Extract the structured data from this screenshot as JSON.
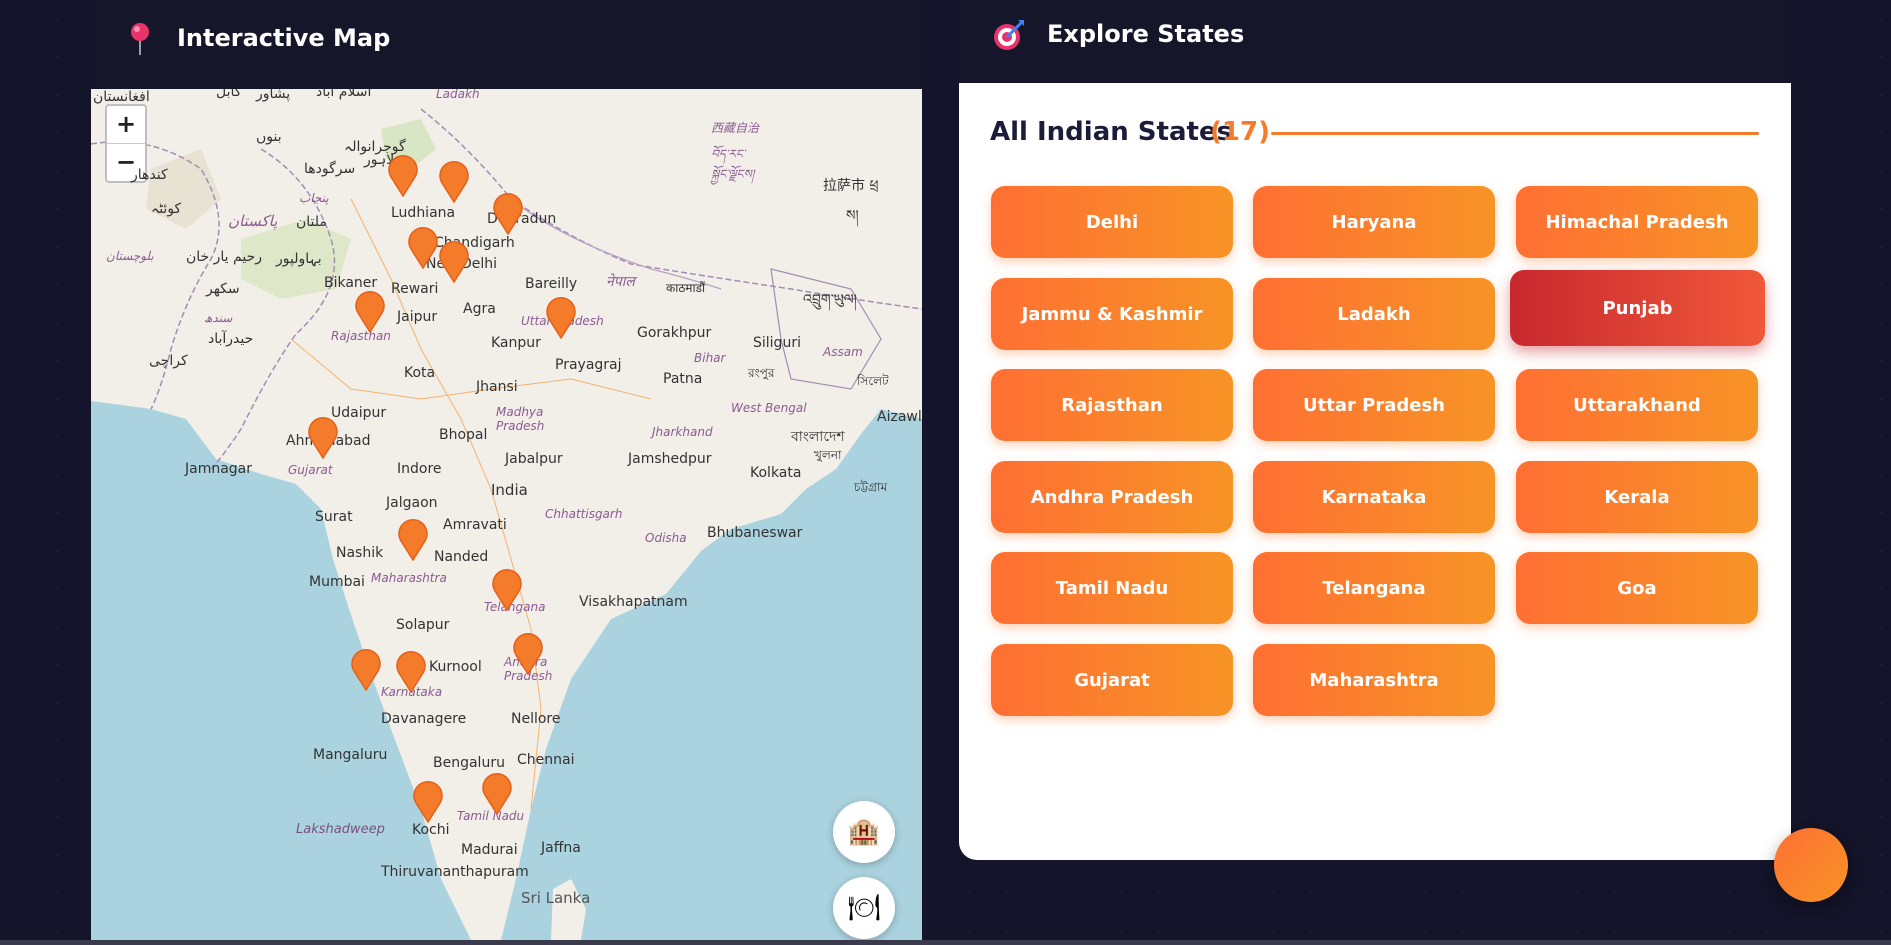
{
  "map_panel": {
    "title": "Interactive Map",
    "pin_icon": "map-pin-icon",
    "zoom_in": "+",
    "zoom_out": "−",
    "labels": {
      "afghanistan": "افغانستان",
      "kabul": "کابل",
      "peshawar": "پشاور",
      "islamabad": "اسلام آباد",
      "ladakh_top": "Ladakh",
      "bannu": "بنوں",
      "gujranwala": "گوجرانوالہ",
      "lahore": "لاہور",
      "sargodha": "سرگودھا",
      "kandahar": "کندھار",
      "punjab_pk": "پنجاب",
      "pakistan": "پاکستان",
      "multan": "ملتان",
      "quetta": "کوئٹہ",
      "bahawalpur": "بہاولپور",
      "balochistan": "بلوچستان",
      "rahim_yar_khan": "رحیم یار خان",
      "sukkur": "سکھر",
      "sindh": "سندھ",
      "hyderabad_pk": "حیدرآباد",
      "karachi": "کراچی",
      "tibet": "西藏自治",
      "tibet2": "བོད་རང་",
      "tibet3": "སྐྱོང་ལྗོངས།",
      "lhasa": "拉萨市 ཕྲ",
      "tibet4": "ས།",
      "ludhiana": "Ludhiana",
      "chandigarh": "Chandigarh",
      "dehradun": "Dehradun",
      "new_delhi": "New Delhi",
      "bikaner": "Bikaner",
      "rewari": "Rewari",
      "bareilly": "Bareilly",
      "nepal": "नेपाल",
      "kathmandu": "काठमाडौं",
      "bhutan": "འབྲུག་ཡུལ།",
      "jaipur": "Jaipur",
      "agra": "Agra",
      "uttar_pradesh": "Uttar Pradesh",
      "gorakhpur": "Gorakhpur",
      "rajasthan": "Rajasthan",
      "kanpur": "Kanpur",
      "siliguri": "Siliguri",
      "assam": "Assam",
      "prayagraj": "Prayagraj",
      "bihar": "Bihar",
      "rangpur": "রংপুর",
      "sylhet": "সিলেট",
      "kota": "Kota",
      "patna": "Patna",
      "jhansi": "Jhansi",
      "udaipur": "Udaipur",
      "madhya_pradesh": "Madhya Pradesh",
      "aizawl": "Aizawl",
      "west_bengal": "West Bengal",
      "bangladesh": "বাংলাদেশ",
      "bhopal": "Bhopal",
      "jharkhand": "Jharkhand",
      "khulna": "খুলনা",
      "ahmedabad": "Ahmedabad",
      "indore": "Indore",
      "jabalpur": "Jabalpur",
      "jamshedpur": "Jamshedpur",
      "jamnagar": "Jamnagar",
      "gujarat": "Gujarat",
      "kolkata": "Kolkata",
      "chittagong": "চট্টগ্রাম",
      "india": "India",
      "jalgaon": "Jalgaon",
      "surat": "Surat",
      "amravati": "Amravati",
      "chhattisgarh": "Chhattisgarh",
      "odisha": "Odisha",
      "bhubaneswar": "Bhubaneswar",
      "nashik": "Nashik",
      "nanded": "Nanded",
      "mumbai": "Mumbai",
      "maharashtra": "Maharashtra",
      "telangana": "Telangana",
      "visakhapatnam": "Visakhapatnam",
      "solapur": "Solapur",
      "kurnool": "Kurnool",
      "andhra_pradesh": "Andhra Pradesh",
      "karnataka": "Karnataka",
      "davanagere": "Davanagere",
      "nellore": "Nellore",
      "mangaluru": "Mangaluru",
      "bengaluru": "Bengaluru",
      "chennai": "Chennai",
      "lakshadweep": "Lakshadweep",
      "kochi": "Kochi",
      "tamil_nadu": "Tamil Nadu",
      "madurai": "Madurai",
      "jaffna": "Jaffna",
      "thiruvananthapuram": "Thiruvananthapuram",
      "sri_lanka": "Sri Lanka"
    },
    "fab_hotel_icon": "🏨",
    "fab_food_icon": "🍽"
  },
  "explore_panel": {
    "title": "Explore States",
    "header_icon": "target-icon",
    "heading": "All Indian States",
    "count": "(17)",
    "states": [
      "Delhi",
      "Haryana",
      "Himachal Pradesh",
      "Jammu & Kashmir",
      "Ladakh",
      "Punjab",
      "Rajasthan",
      "Uttar Pradesh",
      "Uttarakhand",
      "Andhra Pradesh",
      "Karnataka",
      "Kerala",
      "Tamil Nadu",
      "Telangana",
      "Goa",
      "Gujarat",
      "Maharashtra"
    ],
    "active_state": "Punjab"
  },
  "colors": {
    "background": "#14142a",
    "accent": "#f47b2a",
    "active": "#c8282e"
  }
}
